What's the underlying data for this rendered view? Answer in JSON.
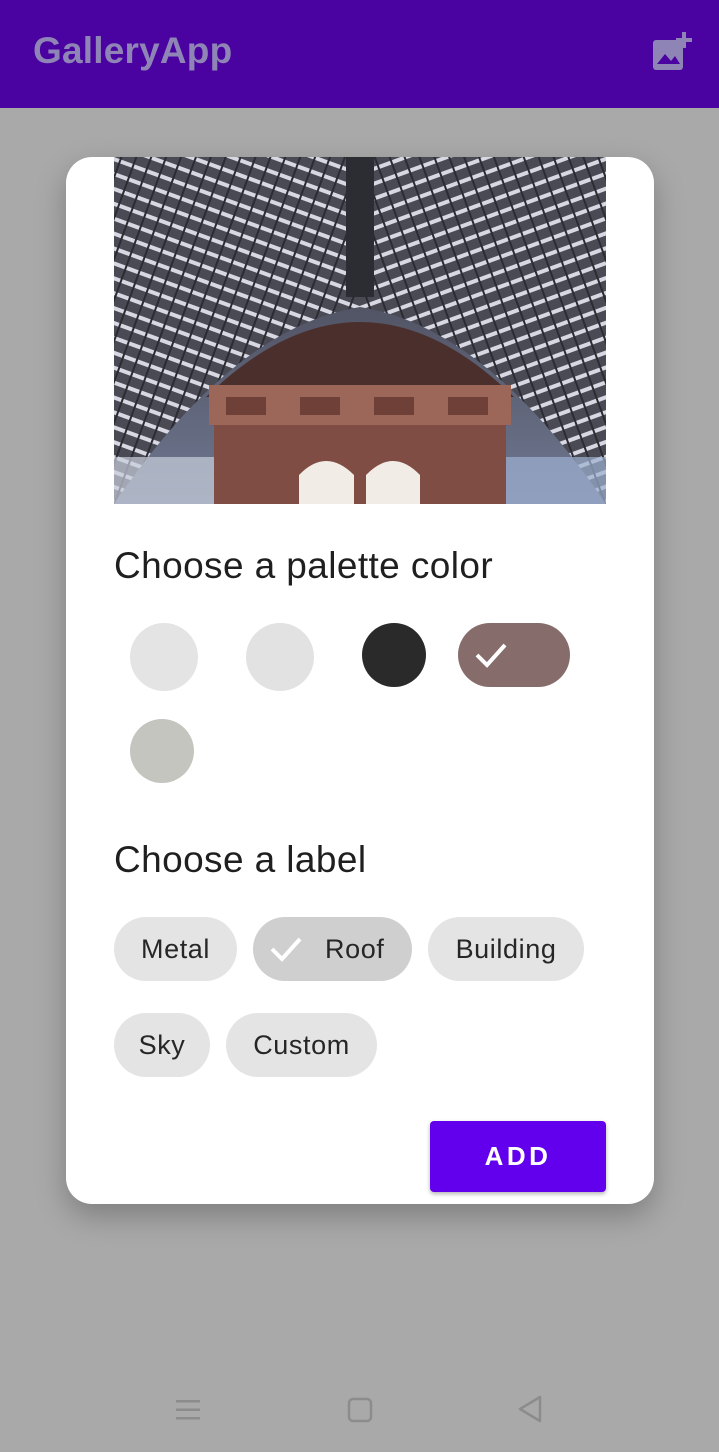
{
  "app_bar": {
    "title": "GalleryApp",
    "action_icon": "add-photo-icon",
    "color": "#4a02a0"
  },
  "dialog": {
    "image_description_icon": "photo-roof-arch",
    "palette_heading": "Choose a palette color",
    "palette_colors": [
      {
        "color": "#e4e4e4",
        "selected": false
      },
      {
        "color": "#e2e2e2",
        "selected": false
      },
      {
        "color": "#2a2a2a",
        "selected": false
      },
      {
        "color": "#876c6c",
        "selected": true
      },
      {
        "color": "#c5c5bf",
        "selected": false
      }
    ],
    "label_heading": "Choose a label",
    "labels": [
      {
        "text": "Metal",
        "selected": false
      },
      {
        "text": "Roof",
        "selected": true
      },
      {
        "text": "Building",
        "selected": false
      },
      {
        "text": "Sky",
        "selected": false
      },
      {
        "text": "Custom",
        "selected": false
      }
    ],
    "add_button": "ADD",
    "accent": "#6200ee"
  },
  "nav_bar": {
    "icons": [
      "menu-icon",
      "home-square-icon",
      "back-triangle-icon"
    ]
  }
}
